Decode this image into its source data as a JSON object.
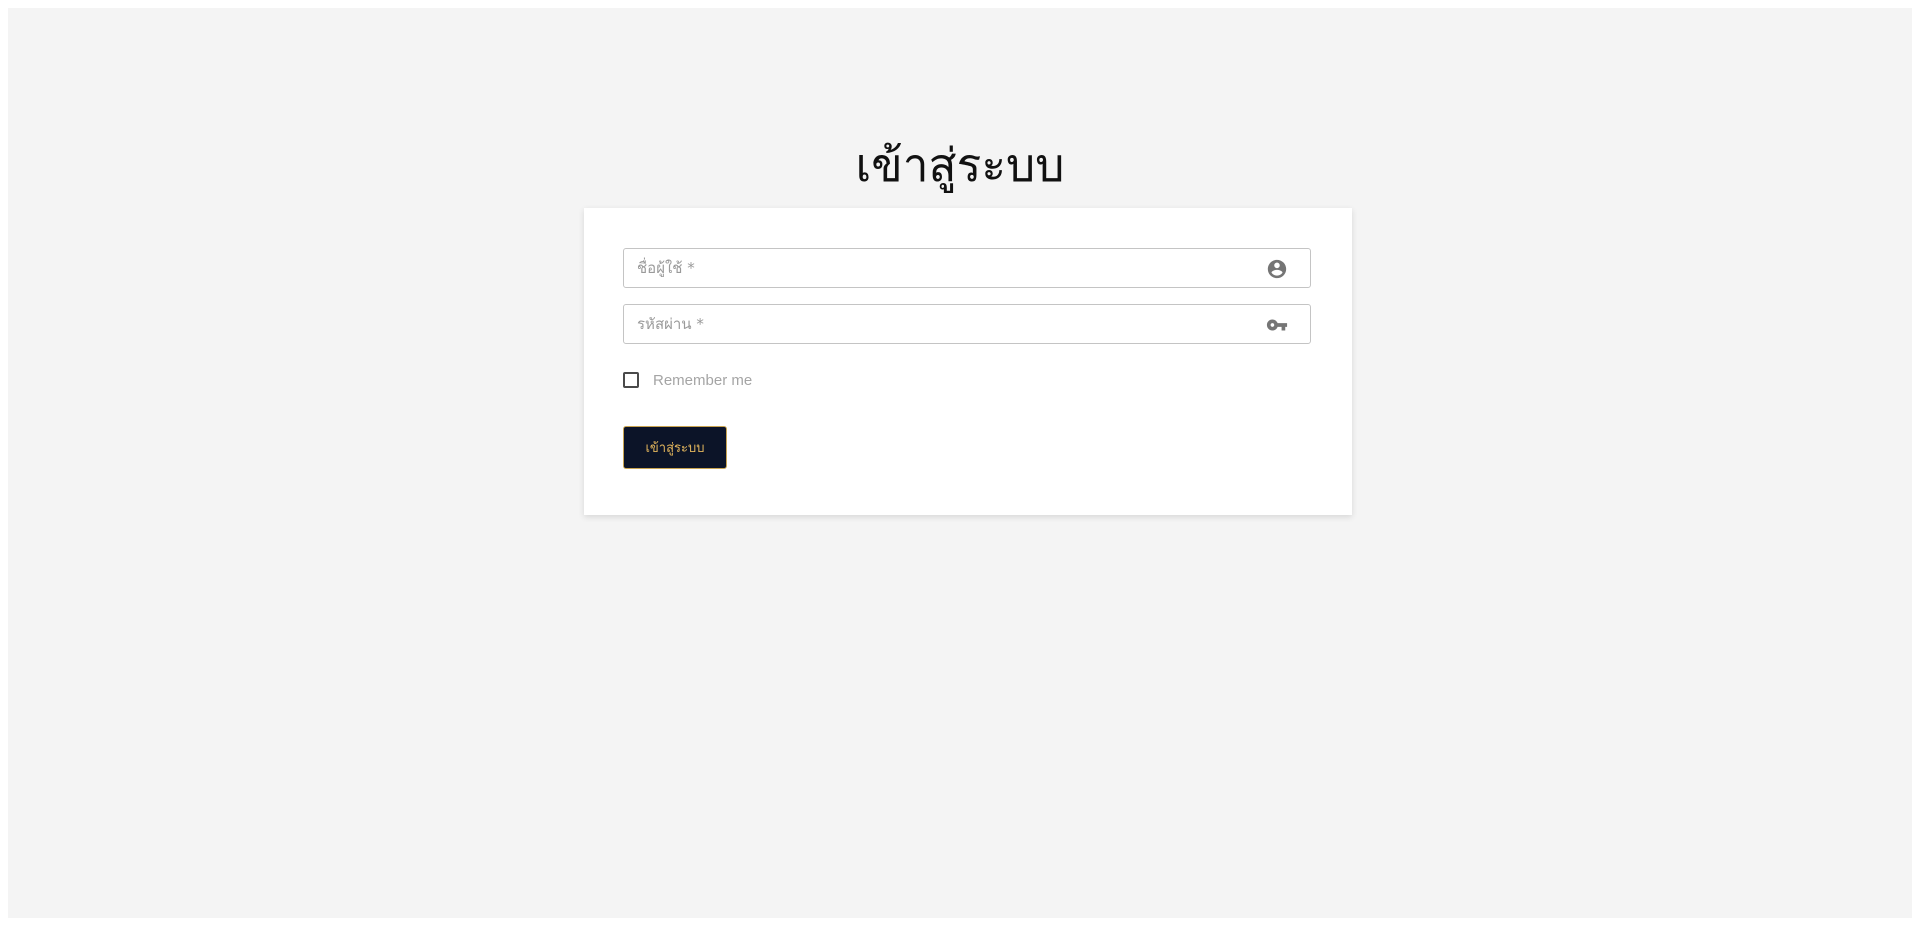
{
  "page": {
    "title": "เข้าสู่ระบบ"
  },
  "form": {
    "username": {
      "placeholder": "ชื่อผู้ใช้ *",
      "value": "",
      "icon": "account-circle-icon"
    },
    "password": {
      "placeholder": "รหัสผ่าน *",
      "value": "",
      "icon": "key-icon"
    },
    "remember": {
      "label": "Remember me",
      "checked": false
    },
    "submit_label": "เข้าสู่ระบบ"
  },
  "colors": {
    "background": "#f4f4f4",
    "card": "#ffffff",
    "button_bg": "#0c1428",
    "button_text": "#e2b55c",
    "icon": "#757575"
  }
}
